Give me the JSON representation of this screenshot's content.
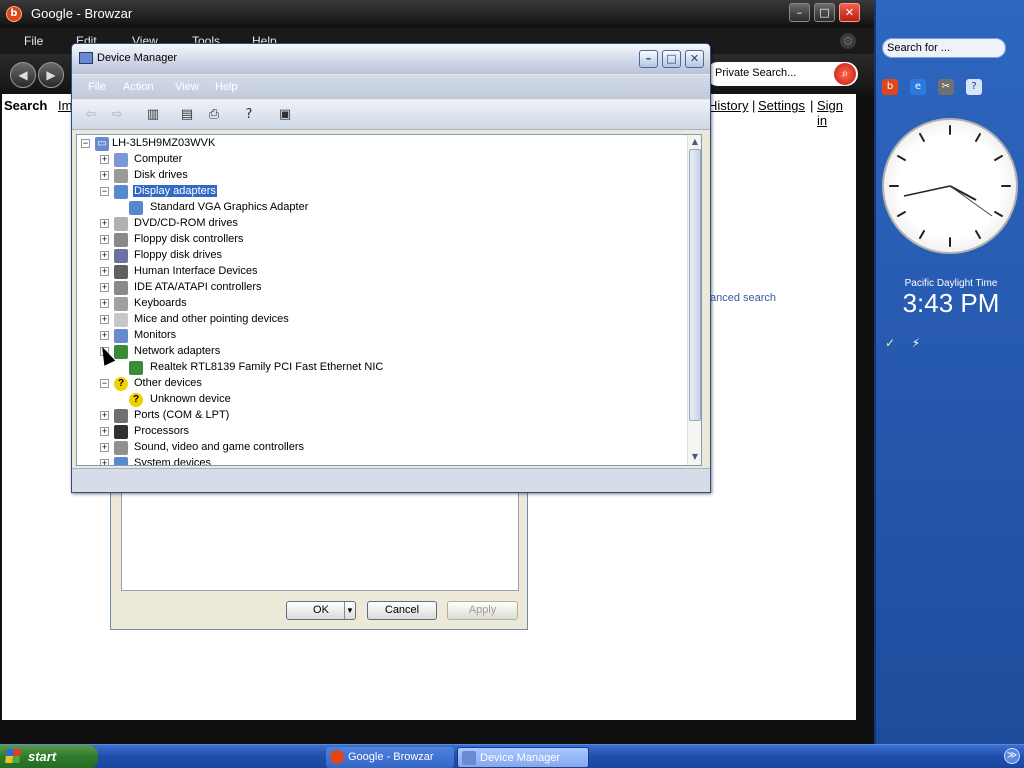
{
  "browser": {
    "title": "Google - Browzar",
    "menu": [
      "File",
      "Edit",
      "View",
      "Tools",
      "Help"
    ],
    "search_placeholder": "Private Search...",
    "content": {
      "left_link_label": "Search",
      "left_link_partial": "Im",
      "right_links": [
        "History",
        "Settings",
        "Sign in"
      ],
      "advanced_search": "anced search"
    }
  },
  "behind_dialog": {
    "buttons": {
      "ok": "OK",
      "cancel": "Cancel",
      "apply": "Apply"
    }
  },
  "device_manager": {
    "title": "Device Manager",
    "menu": [
      "File",
      "Action",
      "View",
      "Help"
    ],
    "tree": {
      "root": "LH-3L5H9MZ03WVK",
      "items": [
        {
          "label": "Computer",
          "expander": "+",
          "icon": "computer-icon"
        },
        {
          "label": "Disk drives",
          "expander": "+",
          "icon": "disk-drive-icon"
        },
        {
          "label": "Display adapters",
          "expander": "−",
          "icon": "display-adapter-icon",
          "selected": true
        },
        {
          "label": "Standard VGA Graphics Adapter",
          "child": true,
          "icon": "display-adapter-icon"
        },
        {
          "label": "DVD/CD-ROM drives",
          "expander": "+",
          "icon": "dvd-drive-icon"
        },
        {
          "label": "Floppy disk controllers",
          "expander": "+",
          "icon": "floppy-controller-icon"
        },
        {
          "label": "Floppy disk drives",
          "expander": "+",
          "icon": "floppy-drive-icon"
        },
        {
          "label": "Human Interface Devices",
          "expander": "+",
          "icon": "hid-icon"
        },
        {
          "label": "IDE ATA/ATAPI controllers",
          "expander": "+",
          "icon": "ide-controller-icon"
        },
        {
          "label": "Keyboards",
          "expander": "+",
          "icon": "keyboard-icon"
        },
        {
          "label": "Mice and other pointing devices",
          "expander": "+",
          "icon": "mouse-icon"
        },
        {
          "label": "Monitors",
          "expander": "+",
          "icon": "monitor-icon"
        },
        {
          "label": "Network adapters",
          "expander": "−",
          "icon": "network-adapter-icon"
        },
        {
          "label": "Realtek RTL8139 Family PCI Fast Ethernet NIC",
          "child": true,
          "icon": "network-card-icon"
        },
        {
          "label": "Other devices",
          "expander": "−",
          "icon": "warning-icon"
        },
        {
          "label": "Unknown device",
          "child": true,
          "icon": "unknown-device-icon"
        },
        {
          "label": "Ports (COM & LPT)",
          "expander": "+",
          "icon": "port-icon"
        },
        {
          "label": "Processors",
          "expander": "+",
          "icon": "processor-icon"
        },
        {
          "label": "Sound, video and game controllers",
          "expander": "+",
          "icon": "sound-icon"
        },
        {
          "label": "System devices",
          "expander": "+",
          "icon": "system-devices-icon"
        }
      ]
    }
  },
  "sidebar": {
    "search_placeholder": "Search for ...",
    "clock": {
      "timezone": "Pacific Daylight Time",
      "time": "3:43 PM"
    }
  },
  "taskbar": {
    "start_label": "start",
    "tasks": [
      "Google - Browzar",
      "Device Manager"
    ]
  }
}
